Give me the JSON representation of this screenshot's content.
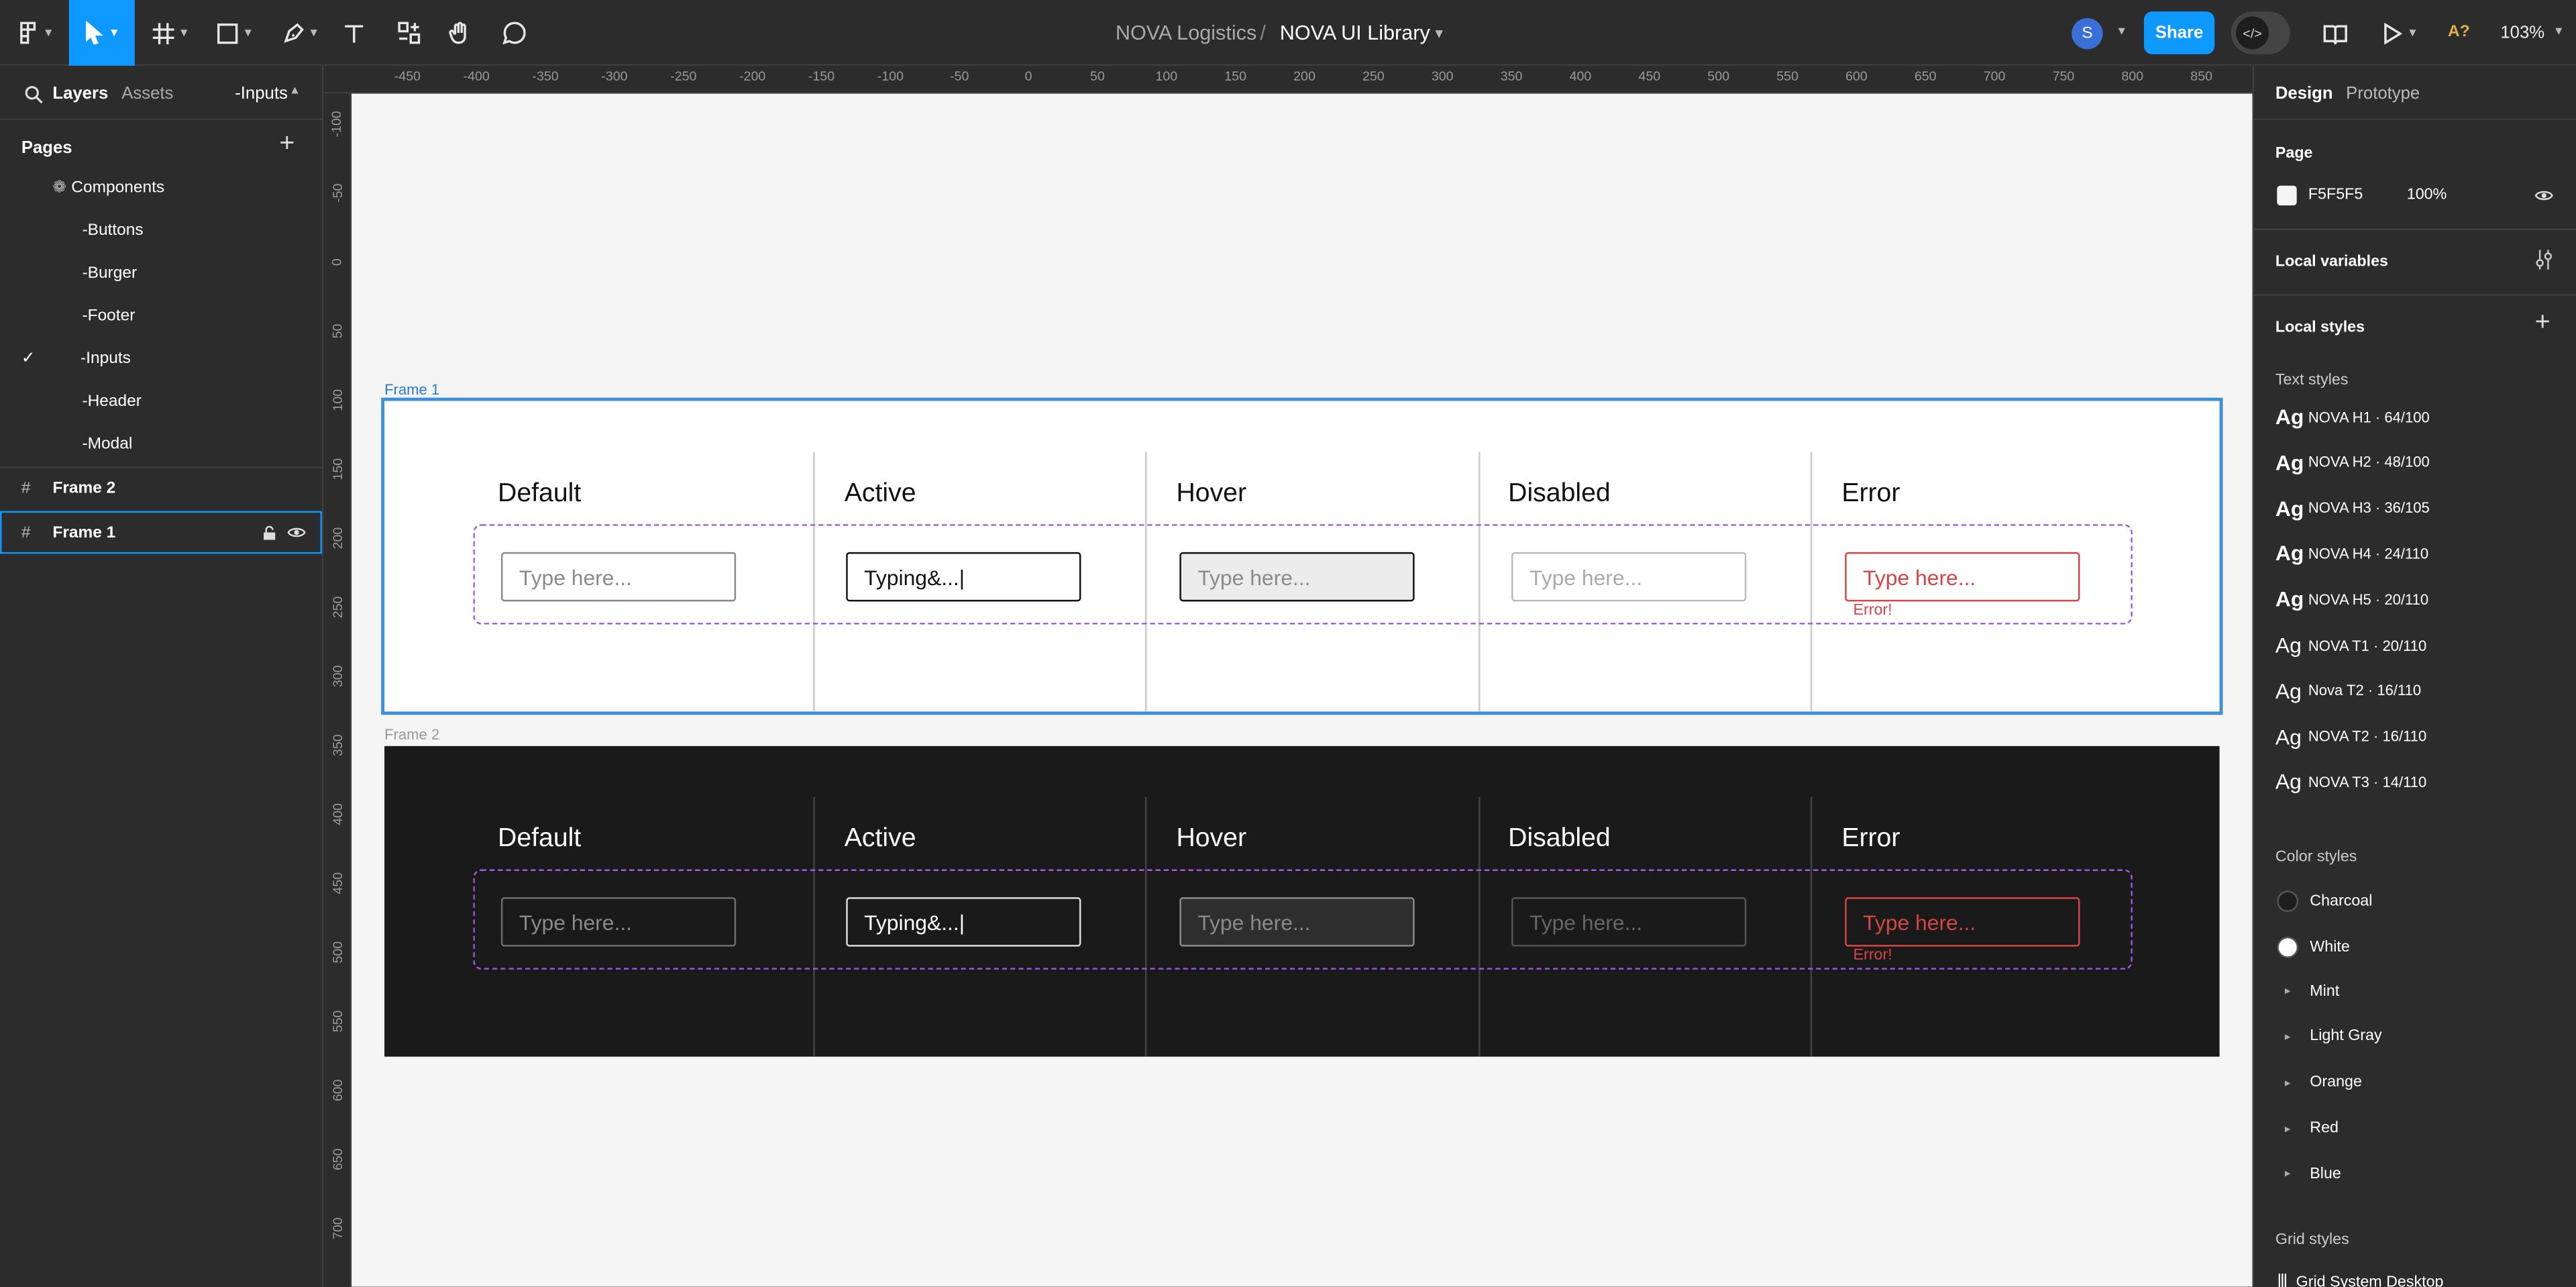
{
  "toolbar": {
    "org": "NOVA Logistics",
    "separator": "/",
    "file": "NOVA UI Library",
    "avatar_initial": "S",
    "share_label": "Share",
    "accessibility_label": "A?",
    "zoom": "103%"
  },
  "left_panel": {
    "tabs": {
      "layers": "Layers",
      "assets": "Assets",
      "current_page": "-Inputs"
    },
    "pages_title": "Pages",
    "layers": [
      {
        "label": "Components"
      },
      {
        "label": "-Buttons"
      },
      {
        "label": "-Burger"
      },
      {
        "label": "-Footer"
      },
      {
        "label": "-Inputs",
        "checked": true
      },
      {
        "label": "-Header"
      },
      {
        "label": "-Modal"
      },
      {
        "label": "Frame 2"
      },
      {
        "label": "Frame 1",
        "selected": true
      }
    ]
  },
  "rulers": {
    "top": [
      "-450",
      "-400",
      "-350",
      "-300",
      "-250",
      "-200",
      "-150",
      "-100",
      "-50",
      "0",
      "50",
      "100",
      "150",
      "200",
      "250",
      "300",
      "350",
      "400",
      "450",
      "500",
      "550",
      "600",
      "650",
      "700",
      "750",
      "800",
      "850"
    ],
    "left": [
      "-100",
      "-50",
      "0",
      "50",
      "100",
      "150",
      "200",
      "250",
      "300",
      "350",
      "400",
      "450",
      "500",
      "550",
      "600",
      "650",
      "700"
    ]
  },
  "canvas": {
    "frames": [
      {
        "label": "Frame 1",
        "theme": "light",
        "states": [
          "Default",
          "Active",
          "Hover",
          "Disabled",
          "Error"
        ],
        "inputs": [
          "Type here...",
          "Typing&...|",
          "Type here...",
          "Type here...",
          "Type here..."
        ],
        "error_message": "Error!"
      },
      {
        "label": "Frame 2",
        "theme": "dark",
        "states": [
          "Default",
          "Active",
          "Hover",
          "Disabled",
          "Error"
        ],
        "inputs": [
          "Type here...",
          "Typing&...|",
          "Type here...",
          "Type here...",
          "Type here..."
        ],
        "error_message": "Error!"
      }
    ]
  },
  "right_panel": {
    "tabs": {
      "design": "Design",
      "prototype": "Prototype"
    },
    "page_title": "Page",
    "page_color": "F5F5F5",
    "page_opacity": "100%",
    "local_variables": "Local variables",
    "local_styles": "Local styles",
    "text_styles_title": "Text styles",
    "text_style_glyph": "Ag",
    "text_styles": [
      "NOVA H1 · 64/100",
      "NOVA H2 · 48/100",
      "NOVA H3 · 36/105",
      "NOVA H4 · 24/110",
      "NOVA H5 · 20/110",
      "NOVA T1 · 20/110",
      "Nova T2 · 16/110",
      "NOVA T2 · 16/110",
      "NOVA T3 · 14/110"
    ],
    "color_styles_title": "Color styles",
    "color_styles": [
      "Charcoal",
      "White",
      "Mint",
      "Light Gray",
      "Orange",
      "Red",
      "Blue"
    ],
    "grid_styles_title": "Grid styles",
    "grid_styles": [
      "Grid System Desktop"
    ]
  },
  "colors": {
    "accent": "#0d99ff",
    "canvas_bg": "#f5f5f5",
    "dark_frame": "#1a1a1a",
    "error": "#d64545",
    "dashed": "#9b59e8"
  }
}
